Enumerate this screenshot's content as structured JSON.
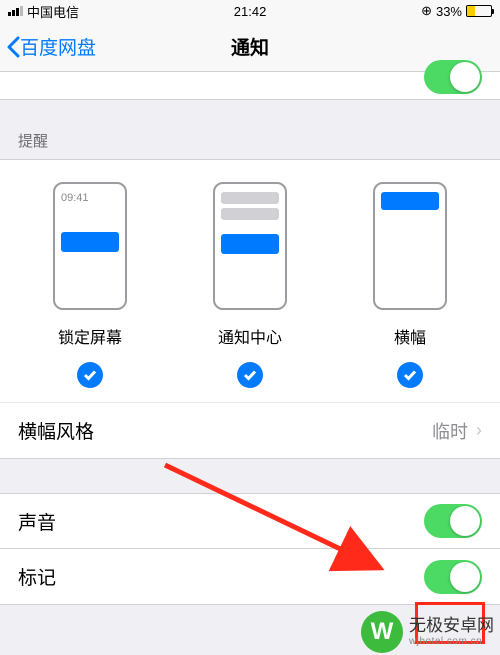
{
  "status": {
    "carrier": "中国电信",
    "time": "21:42",
    "battery_pct": "33%"
  },
  "nav": {
    "back": "百度网盘",
    "title": "通知"
  },
  "reminders": {
    "header": "提醒",
    "styles": [
      {
        "label": "锁定屏幕",
        "checked": true,
        "preview_time": "09:41"
      },
      {
        "label": "通知中心",
        "checked": true
      },
      {
        "label": "横幅",
        "checked": true
      }
    ],
    "banner_style_row": {
      "label": "横幅风格",
      "value": "临时"
    }
  },
  "toggles": {
    "sound": {
      "label": "声音",
      "on": true
    },
    "badge": {
      "label": "标记",
      "on": true
    }
  },
  "watermark": {
    "cn": "无极安卓网",
    "en": "wjhotel.com.cn",
    "glyph": "W"
  }
}
